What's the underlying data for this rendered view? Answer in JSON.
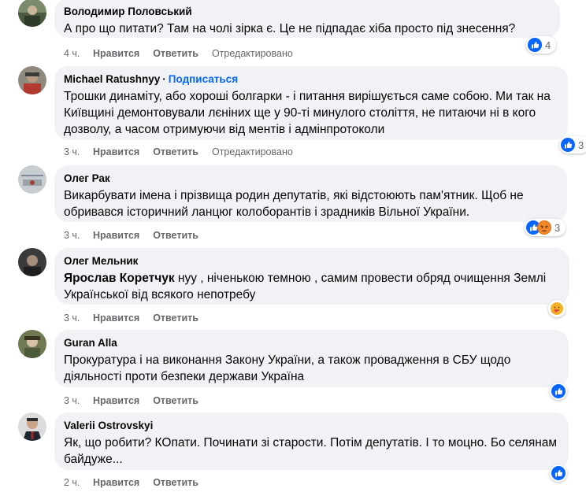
{
  "actions": {
    "like": "Нравится",
    "reply": "Ответить",
    "edited": "Отредактировано"
  },
  "comments": [
    {
      "author": "Володимир Половський",
      "text": "А про що питати? Там на чолі зірка є. Це не підпадає хіба просто під знесення?",
      "time": "4 ч.",
      "edited": true,
      "reactions": [
        "like-icon"
      ],
      "reaction_count": "4"
    },
    {
      "author": "Michael Ratushnyy",
      "follow": "Подписаться",
      "text": "Трошки динаміту, або хороші болгарки - і питання вирішується саме собою. Ми так на Київщині демонтовували лєніних ще у 90-ті минулого століття, не питаючи ні в кого дозволу, а часом отримуючи від ментів і адмінпротоколи",
      "time": "3 ч.",
      "edited": true,
      "reactions": [
        "like-icon"
      ],
      "reaction_count": "3"
    },
    {
      "author": "Олег Рак",
      "text": "Викарбувати імена і прізвища родин депутатів, які відстоюють пам'ятник. Щоб не обривався історичний ланцюг колоборантів і зрадників Вільної України.",
      "time": "3 ч.",
      "edited": false,
      "reactions": [
        "like-icon",
        "angry-icon"
      ],
      "reaction_count": "3"
    },
    {
      "author": "Олег Мельник",
      "mention": "Ярослав Коретчук",
      "text": " нуу , ніченькою темною , самим провести обряд очищення Землі Української від всякого непотребу",
      "time": "3 ч.",
      "edited": false,
      "reactions": [
        "care-icon"
      ],
      "reaction_count": ""
    },
    {
      "author": "Guran Alla",
      "text": "Прокуратура і на виконання Закону України, а також провадження в СБУ щодо діяльності проти безпеки держави Україна",
      "time": "3 ч.",
      "edited": false,
      "reactions": [
        "like-icon"
      ],
      "reaction_count": ""
    },
    {
      "author": "Valerii Ostrovskyi",
      "text": "Як, що робити? КОпати. Починати зі старости. Потім депутатів. І то моцно. Бо селянам байдуже...",
      "time": "2 ч.",
      "edited": false,
      "reactions": [
        "like-icon"
      ],
      "reaction_count": ""
    }
  ],
  "colors": {
    "like": "#0866ff",
    "angry": "#e9710f",
    "care": "#f7b125",
    "bubble": "#f0f2f5",
    "meta": "#65676b"
  }
}
